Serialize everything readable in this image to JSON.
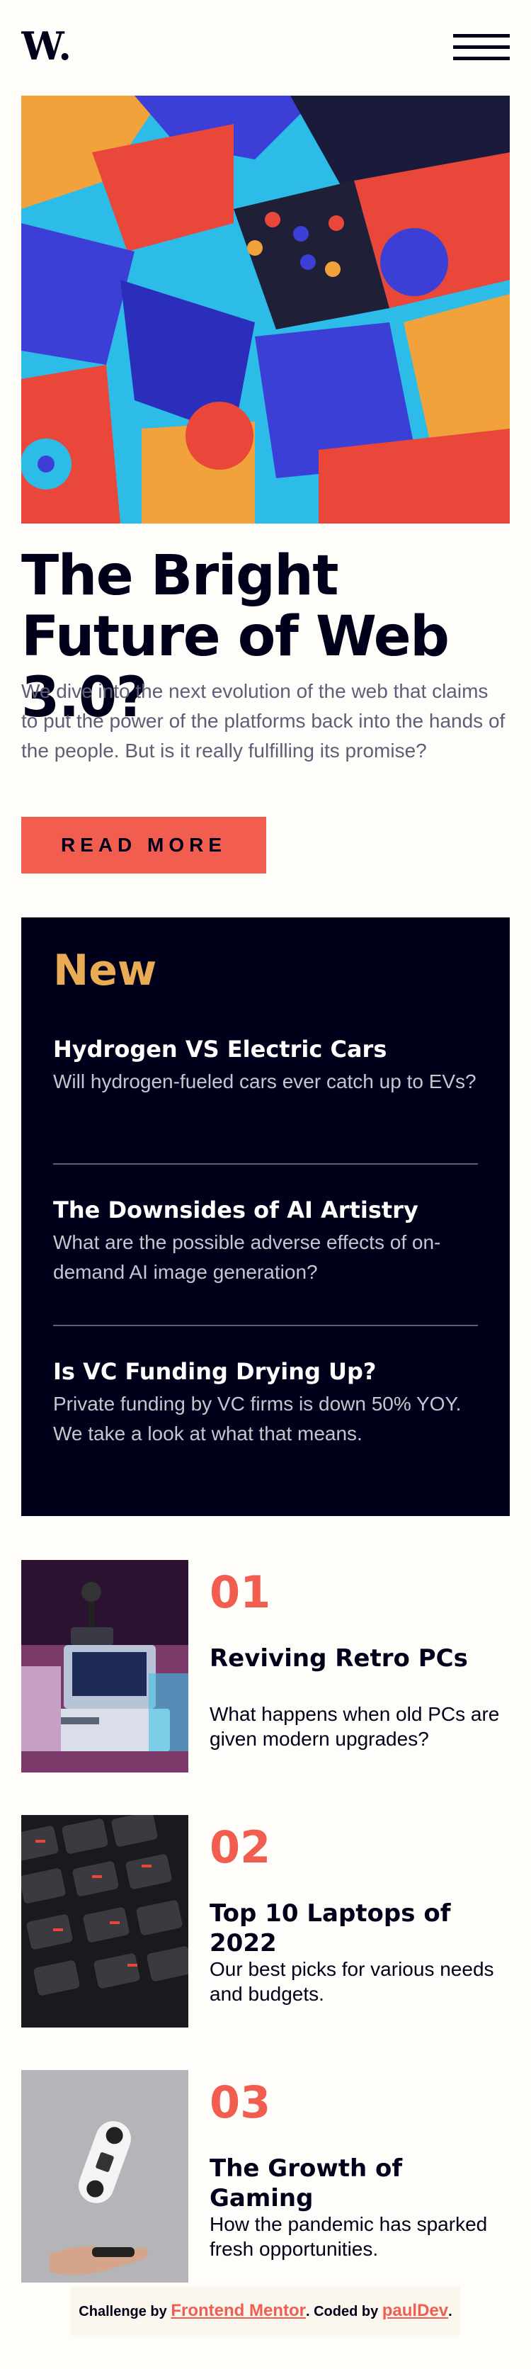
{
  "brand": {
    "logo_text": "W.",
    "accent": "#f15e50",
    "highlight": "#e9ab53",
    "dark": "#00001a"
  },
  "header": {
    "logo_icon": "w-logo-icon",
    "menu_icon": "hamburger-menu-icon"
  },
  "hero": {
    "image": "abstract-3d-blocks-image",
    "headline": "The Bright Future of Web 3.0?",
    "intro": "We dive into the next evolution of the web that claims to put the power of the platforms back into the hands of the people. But is it really fulfilling its promise?",
    "cta": "READ MORE"
  },
  "new_panel": {
    "title": "New",
    "items": [
      {
        "title": "Hydrogen VS Electric Cars",
        "desc": "Will hydrogen-fueled cars ever catch up to EVs?"
      },
      {
        "title": "The Downsides of AI Artistry",
        "desc": "What are the possible adverse effects of on-demand AI image generation?"
      },
      {
        "title": "Is VC Funding Drying Up?",
        "desc": "Private funding by VC firms is down 50% YOY. We take a look at what that means."
      }
    ]
  },
  "articles": [
    {
      "number": "01",
      "title": "Reviving Retro PCs",
      "desc": "What happens when old PCs are given modern upgrades?",
      "image": "retro-pc-image"
    },
    {
      "number": "02",
      "title": "Top 10 Laptops of 2022",
      "desc": "Our best picks for various needs and budgets.",
      "image": "keyboard-image"
    },
    {
      "number": "03",
      "title": "The Growth of Gaming",
      "desc": "How the pandemic has sparked fresh opportunities.",
      "image": "gamepad-image"
    }
  ],
  "attribution": {
    "prefix": "Challenge by ",
    "link1": "Frontend Mentor",
    "middle": ". Coded by ",
    "link2": "paulDev",
    "suffix": "."
  }
}
